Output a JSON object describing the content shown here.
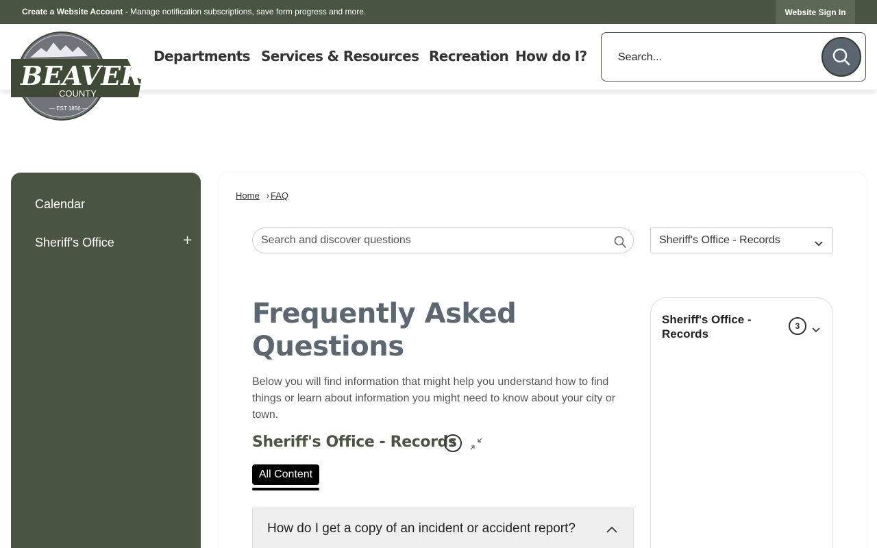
{
  "topbar": {
    "account_link": "Create a Website Account",
    "account_desc": " - Manage notification subscriptions, save form progress and more.",
    "signin": "Website Sign In"
  },
  "logo": {
    "name": "BEAVER",
    "sub": "COUNTY",
    "est": "— EST 1856 —"
  },
  "nav": {
    "items": [
      "Departments",
      "Services & Resources",
      "Recreation",
      "How do I?"
    ]
  },
  "site_search": {
    "placeholder": "Search..."
  },
  "sidebar": {
    "items": [
      {
        "label": "Calendar"
      },
      {
        "label": "Sheriff's Office",
        "expander": "+"
      }
    ]
  },
  "breadcrumb": {
    "home": "Home",
    "sep": "›",
    "current": "FAQ"
  },
  "faq_search": {
    "placeholder": "Search and discover questions"
  },
  "category_select": {
    "value": "Sheriff's Office - Records"
  },
  "main": {
    "title": "Frequently Asked Questions",
    "intro": "Below you will find information that might help you understand how to find things or learn about information you might need to know about your city or town.",
    "section_title": "Sheriff's Office - Records",
    "section_count": "3",
    "tab_label": "All Content",
    "question": "How do I get a copy of an incident or accident report?"
  },
  "category_panel": {
    "name": "Sheriff's Office - Records",
    "count": "3"
  },
  "colors": {
    "brand_green": "#4a5443",
    "title_slate": "#5c6772"
  }
}
